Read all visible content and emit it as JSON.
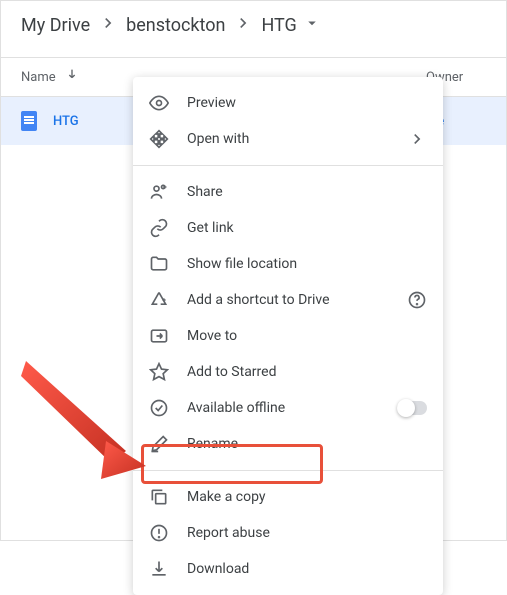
{
  "breadcrumb": {
    "root": "My Drive",
    "folder": "benstockton",
    "current": "HTG"
  },
  "columns": {
    "name": "Name",
    "owner": "Owner"
  },
  "file": {
    "name": "HTG",
    "owner": "me"
  },
  "menu": {
    "preview": "Preview",
    "open_with": "Open with",
    "share": "Share",
    "get_link": "Get link",
    "show_location": "Show file location",
    "add_shortcut": "Add a shortcut to Drive",
    "move_to": "Move to",
    "add_starred": "Add to Starred",
    "available_offline": "Available offline",
    "rename": "Rename",
    "make_copy": "Make a copy",
    "report_abuse": "Report abuse",
    "download": "Download"
  }
}
